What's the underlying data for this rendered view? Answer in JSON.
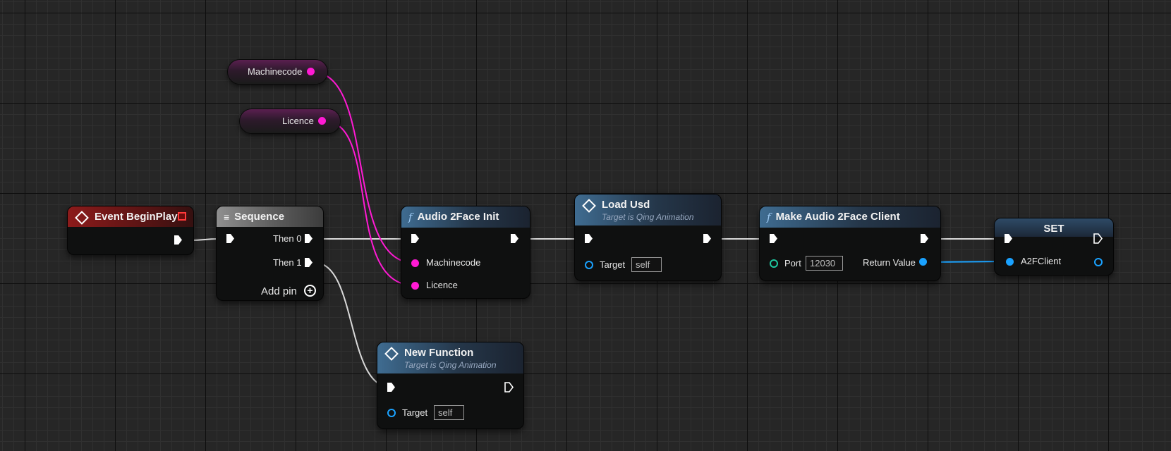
{
  "nodes": {
    "event_begin_play": {
      "title": "Event BeginPlay"
    },
    "sequence": {
      "title": "Sequence",
      "then0": "Then 0",
      "then1": "Then 1",
      "add_pin": "Add pin"
    },
    "audio2face_init": {
      "title": "Audio 2Face Init",
      "pin_machinecode": "Machinecode",
      "pin_licence": "Licence"
    },
    "load_usd": {
      "title": "Load Usd",
      "subtitle": "Target is Qing Animation",
      "target_label": "Target",
      "target_value": "self"
    },
    "make_client": {
      "title": "Make Audio 2Face Client",
      "port_label": "Port",
      "port_value": "12030",
      "return_label": "Return Value"
    },
    "set": {
      "title": "SET",
      "var_label": "A2FClient"
    },
    "new_function": {
      "title": "New Function",
      "subtitle": "Target is Qing Animation",
      "target_label": "Target",
      "target_value": "self"
    }
  },
  "variables": {
    "machinecode": "Machinecode",
    "licence": "Licence"
  },
  "colors": {
    "string_pin": "#ff1ad4",
    "object_pin": "#1aa2ff",
    "int_pin": "#1fc8a0",
    "exec_pin": "#ffffff",
    "event_header": "#8c1b1b",
    "function_header": "#3f6c91"
  },
  "icons": {
    "event": "diamond-icon",
    "function": "function-f-icon",
    "sequence": "sequence-icon",
    "add": "plus-circle-icon"
  }
}
